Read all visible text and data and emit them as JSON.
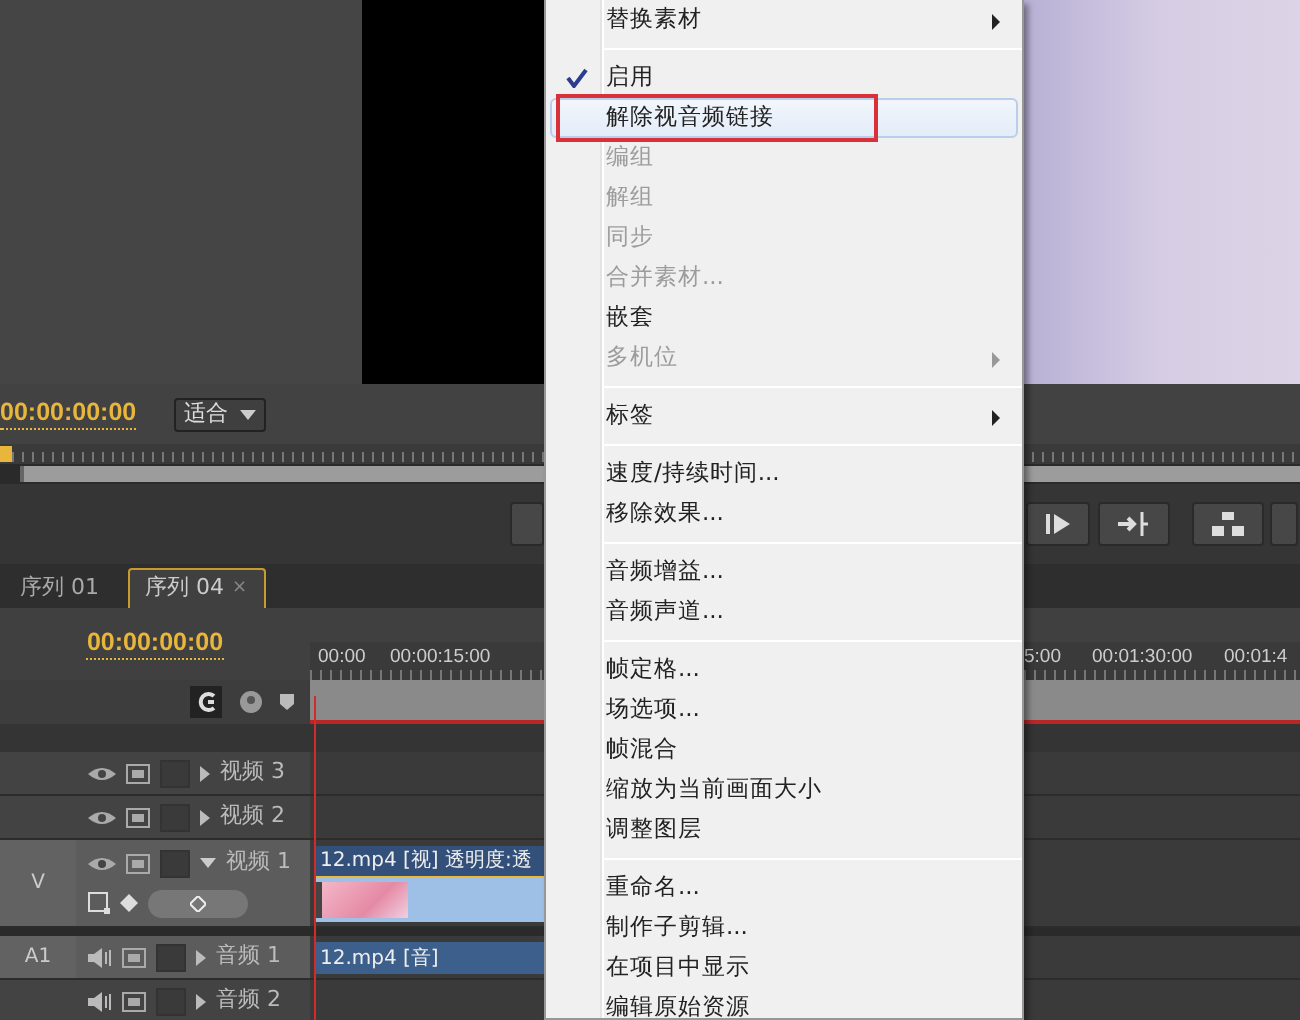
{
  "monitor": {
    "timecode": "00:00:00:00",
    "zoom_dropdown": "适合"
  },
  "sequence_tabs": [
    {
      "label": "序列 01",
      "selected": false
    },
    {
      "label": "序列 04",
      "selected": true,
      "close": "×"
    }
  ],
  "timeline": {
    "timecode": "00:00:00:00",
    "ruler_left": [
      "00:00",
      "00:00:15:00"
    ],
    "ruler_right": [
      "5:00",
      "00:01:30:00",
      "00:01:4"
    ],
    "tracks": [
      {
        "kind": "video",
        "name": "视频 3",
        "expanded": false
      },
      {
        "kind": "video",
        "name": "视频 2",
        "expanded": false
      },
      {
        "kind": "video",
        "name": "视频 1",
        "label": "V",
        "expanded": true,
        "clip": "12.mp4 [视] 透明度:透"
      },
      {
        "kind": "audio",
        "name": "音频 1",
        "label": "A1",
        "expanded": false,
        "clip": "12.mp4 [音]"
      },
      {
        "kind": "audio",
        "name": "音频 2",
        "expanded": false
      }
    ]
  },
  "context_menu": {
    "items": [
      {
        "kind": "item",
        "label": "替换素材",
        "submenu": true,
        "disabled": false,
        "checked": false,
        "selected": false
      },
      {
        "kind": "separator"
      },
      {
        "kind": "item",
        "label": "启用",
        "submenu": false,
        "disabled": false,
        "checked": true,
        "selected": false
      },
      {
        "kind": "item",
        "label": "解除视音频链接",
        "submenu": false,
        "disabled": false,
        "checked": false,
        "selected": true,
        "outlined": true
      },
      {
        "kind": "item",
        "label": "编组",
        "submenu": false,
        "disabled": true,
        "checked": false,
        "selected": false
      },
      {
        "kind": "item",
        "label": "解组",
        "submenu": false,
        "disabled": true,
        "checked": false,
        "selected": false
      },
      {
        "kind": "item",
        "label": "同步",
        "submenu": false,
        "disabled": true,
        "checked": false,
        "selected": false
      },
      {
        "kind": "item",
        "label": "合并素材...",
        "submenu": false,
        "disabled": true,
        "checked": false,
        "selected": false
      },
      {
        "kind": "item",
        "label": "嵌套",
        "submenu": false,
        "disabled": false,
        "checked": false,
        "selected": false
      },
      {
        "kind": "item",
        "label": "多机位",
        "submenu": true,
        "disabled": true,
        "checked": false,
        "selected": false
      },
      {
        "kind": "separator"
      },
      {
        "kind": "item",
        "label": "标签",
        "submenu": true,
        "disabled": false,
        "checked": false,
        "selected": false
      },
      {
        "kind": "separator"
      },
      {
        "kind": "item",
        "label": "速度/持续时间...",
        "submenu": false,
        "disabled": false,
        "checked": false,
        "selected": false
      },
      {
        "kind": "item",
        "label": "移除效果...",
        "submenu": false,
        "disabled": false,
        "checked": false,
        "selected": false
      },
      {
        "kind": "separator"
      },
      {
        "kind": "item",
        "label": "音频增益...",
        "submenu": false,
        "disabled": false,
        "checked": false,
        "selected": false
      },
      {
        "kind": "item",
        "label": "音频声道...",
        "submenu": false,
        "disabled": false,
        "checked": false,
        "selected": false
      },
      {
        "kind": "separator"
      },
      {
        "kind": "item",
        "label": "帧定格...",
        "submenu": false,
        "disabled": false,
        "checked": false,
        "selected": false
      },
      {
        "kind": "item",
        "label": "场选项...",
        "submenu": false,
        "disabled": false,
        "checked": false,
        "selected": false
      },
      {
        "kind": "item",
        "label": "帧混合",
        "submenu": false,
        "disabled": false,
        "checked": false,
        "selected": false
      },
      {
        "kind": "item",
        "label": "缩放为当前画面大小",
        "submenu": false,
        "disabled": false,
        "checked": false,
        "selected": false
      },
      {
        "kind": "item",
        "label": "调整图层",
        "submenu": false,
        "disabled": false,
        "checked": false,
        "selected": false
      },
      {
        "kind": "separator"
      },
      {
        "kind": "item",
        "label": "重命名...",
        "submenu": false,
        "disabled": false,
        "checked": false,
        "selected": false
      },
      {
        "kind": "item",
        "label": "制作子剪辑...",
        "submenu": false,
        "disabled": false,
        "checked": false,
        "selected": false
      },
      {
        "kind": "item",
        "label": "在项目中显示",
        "submenu": false,
        "disabled": false,
        "checked": false,
        "selected": false
      },
      {
        "kind": "item",
        "label": "编辑原始资源",
        "submenu": false,
        "disabled": false,
        "checked": false,
        "selected": false
      }
    ]
  }
}
